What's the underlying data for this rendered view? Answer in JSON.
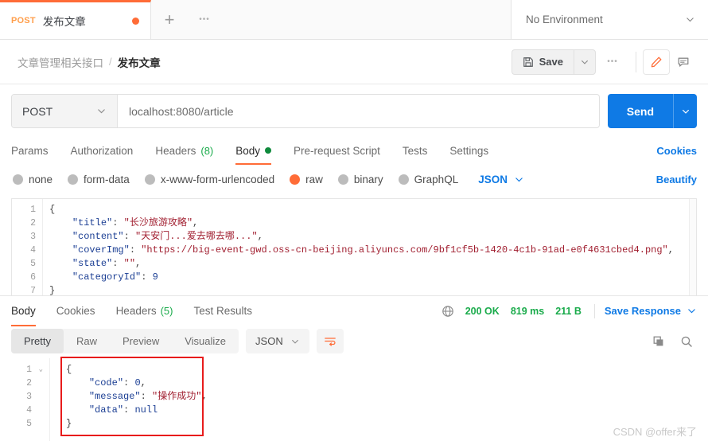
{
  "tabstrip": {
    "request_tab": {
      "method": "POST",
      "name": "发布文章",
      "unsaved": true
    },
    "new_tab_icon": "+",
    "more_tabs_icon": "•••",
    "environment": {
      "label": "No Environment"
    }
  },
  "breadcrumb": {
    "collection": "文章管理相关接口",
    "separator": "/",
    "current": "发布文章"
  },
  "toolbar": {
    "save_label": "Save",
    "more_label": "•••"
  },
  "url_bar": {
    "method": "POST",
    "url": "localhost:8080/article",
    "send_label": "Send"
  },
  "request_tabs": {
    "items": [
      {
        "label": "Params",
        "active": false
      },
      {
        "label": "Authorization",
        "active": false
      },
      {
        "label": "Headers",
        "count": "(8)",
        "active": false
      },
      {
        "label": "Body",
        "active": true,
        "dot": true
      },
      {
        "label": "Pre-request Script",
        "active": false
      },
      {
        "label": "Tests",
        "active": false
      },
      {
        "label": "Settings",
        "active": false
      }
    ],
    "cookies_link": "Cookies"
  },
  "body_types": {
    "options": [
      {
        "label": "none",
        "selected": false
      },
      {
        "label": "form-data",
        "selected": false
      },
      {
        "label": "x-www-form-urlencoded",
        "selected": false
      },
      {
        "label": "raw",
        "selected": true
      },
      {
        "label": "binary",
        "selected": false
      },
      {
        "label": "GraphQL",
        "selected": false
      }
    ],
    "format": "JSON",
    "beautify_link": "Beautify"
  },
  "request_body": {
    "line_numbers": [
      "1",
      "2",
      "3",
      "4",
      "5",
      "6",
      "7"
    ],
    "lines": [
      [
        {
          "t": "{",
          "c": "p"
        }
      ],
      [
        {
          "t": "    ",
          "c": "p"
        },
        {
          "t": "\"title\"",
          "c": "k"
        },
        {
          "t": ": ",
          "c": "p"
        },
        {
          "t": "\"长沙旅游攻略\"",
          "c": "s"
        },
        {
          "t": ",",
          "c": "p"
        }
      ],
      [
        {
          "t": "    ",
          "c": "p"
        },
        {
          "t": "\"content\"",
          "c": "k"
        },
        {
          "t": ": ",
          "c": "p"
        },
        {
          "t": "\"天安门...爱去哪去哪...\"",
          "c": "s"
        },
        {
          "t": ",",
          "c": "p"
        }
      ],
      [
        {
          "t": "    ",
          "c": "p"
        },
        {
          "t": "\"coverImg\"",
          "c": "k"
        },
        {
          "t": ": ",
          "c": "p"
        },
        {
          "t": "\"https://big-event-gwd.oss-cn-beijing.aliyuncs.com/9bf1cf5b-1420-4c1b-91ad-e0f4631cbed4.png\"",
          "c": "s"
        },
        {
          "t": ",",
          "c": "p"
        }
      ],
      [
        {
          "t": "    ",
          "c": "p"
        },
        {
          "t": "\"state\"",
          "c": "k"
        },
        {
          "t": ": ",
          "c": "p"
        },
        {
          "t": "\"\"",
          "c": "s"
        },
        {
          "t": ",",
          "c": "p"
        }
      ],
      [
        {
          "t": "    ",
          "c": "p"
        },
        {
          "t": "\"categoryId\"",
          "c": "k"
        },
        {
          "t": ": ",
          "c": "p"
        },
        {
          "t": "9",
          "c": "n"
        }
      ],
      [
        {
          "t": "}",
          "c": "p"
        }
      ]
    ]
  },
  "response": {
    "tabs": [
      {
        "label": "Body",
        "active": true
      },
      {
        "label": "Cookies",
        "active": false
      },
      {
        "label": "Headers",
        "count": "(5)",
        "active": false
      },
      {
        "label": "Test Results",
        "active": false
      }
    ],
    "status": "200 OK",
    "time": "819 ms",
    "size": "211 B",
    "save_response": "Save Response",
    "view_modes": [
      {
        "label": "Pretty",
        "active": true
      },
      {
        "label": "Raw",
        "active": false
      },
      {
        "label": "Preview",
        "active": false
      },
      {
        "label": "Visualize",
        "active": false
      }
    ],
    "format": "JSON",
    "line_numbers": [
      "1",
      "2",
      "3",
      "4",
      "5"
    ],
    "lines": [
      [
        {
          "t": "{",
          "c": "p"
        }
      ],
      [
        {
          "t": "    ",
          "c": "p"
        },
        {
          "t": "\"code\"",
          "c": "k"
        },
        {
          "t": ": ",
          "c": "p"
        },
        {
          "t": "0",
          "c": "n"
        },
        {
          "t": ",",
          "c": "p"
        }
      ],
      [
        {
          "t": "    ",
          "c": "p"
        },
        {
          "t": "\"message\"",
          "c": "k"
        },
        {
          "t": ": ",
          "c": "p"
        },
        {
          "t": "\"操作成功\"",
          "c": "s"
        },
        {
          "t": ",",
          "c": "p"
        }
      ],
      [
        {
          "t": "    ",
          "c": "p"
        },
        {
          "t": "\"data\"",
          "c": "k"
        },
        {
          "t": ": ",
          "c": "p"
        },
        {
          "t": "null",
          "c": "n"
        }
      ],
      [
        {
          "t": "}",
          "c": "p"
        }
      ]
    ]
  },
  "watermark": "CSDN @offer来了",
  "colors": {
    "accent_orange": "#ff6c37",
    "send_blue": "#0f7ae5",
    "status_green": "#1aab4b",
    "annotation_red": "#e81c1c"
  }
}
